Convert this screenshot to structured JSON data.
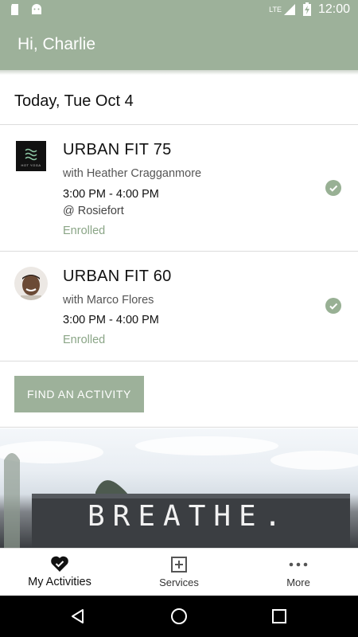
{
  "status_bar": {
    "network": "LTE",
    "time": "12:00"
  },
  "header": {
    "greeting": "Hi, Charlie"
  },
  "date_heading": "Today, Tue Oct 4",
  "activities": [
    {
      "title": "URBAN FIT 75",
      "instructor": "with Heather Cragganmore",
      "time": "3:00 PM - 4:00 PM",
      "location": "@ Rosiefort",
      "status": "Enrolled",
      "logo_text": "HOT YOGA"
    },
    {
      "title": "URBAN FIT 60",
      "instructor": "with Marco Flores",
      "time": "3:00 PM - 4:00 PM",
      "status": "Enrolled"
    }
  ],
  "find_button": "FIND AN ACTIVITY",
  "banner_text": "BREATHE.",
  "bottom_nav": [
    {
      "label": "My Activities",
      "icon": "heart-check-icon",
      "active": true
    },
    {
      "label": "Services",
      "icon": "plus-square-icon",
      "active": false
    },
    {
      "label": "More",
      "icon": "more-dots-icon",
      "active": false
    }
  ],
  "colors": {
    "accent": "#9db19a",
    "enrolled": "#8aa586"
  }
}
